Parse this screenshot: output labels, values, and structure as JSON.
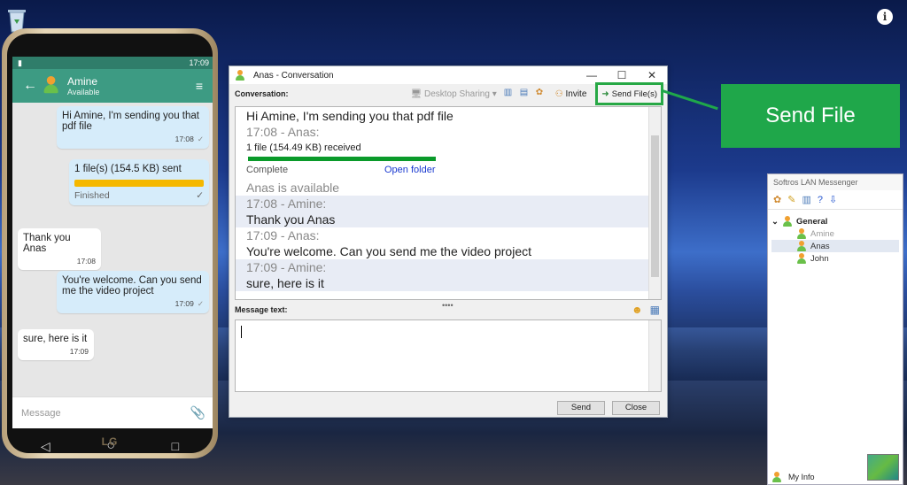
{
  "phone": {
    "status_time": "17:09",
    "contact_name": "Amine",
    "contact_status": "Available",
    "messages": [
      {
        "text": "Hi Amine, I'm sending you that pdf file",
        "time": "17:08"
      },
      {
        "text": "1 file(s)  (154.5 KB) sent",
        "status": "Finished",
        "progress": 1.0
      },
      {
        "text": "Thank you Anas",
        "time": "17:08"
      },
      {
        "text": "You're welcome. Can you send me the video project",
        "time": "17:09"
      },
      {
        "text": "sure, here is it",
        "time": "17:09"
      }
    ],
    "input_placeholder": "Message",
    "brand": "LG"
  },
  "window": {
    "title": "Anas - Conversation",
    "conversation_label": "Conversation:",
    "desktop_sharing": "Desktop Sharing",
    "invite": "Invite",
    "send_files": "Send File(s)",
    "lines": [
      {
        "text": "Hi Amine, I'm sending you that pdf file"
      },
      {
        "text": "17:08 - Anas:"
      },
      {
        "text": "1 file (154.49 KB) received"
      },
      {
        "text": "Complete",
        "link": "Open folder"
      },
      {
        "text": "Anas is available"
      },
      {
        "text": "17:08 - Amine:"
      },
      {
        "text": "Thank you Anas"
      },
      {
        "text": "17:09 - Anas:"
      },
      {
        "text": "You're welcome. Can you send me the video project"
      },
      {
        "text": "17:09 - Amine:"
      },
      {
        "text": "sure, here is it"
      }
    ],
    "message_label": "Message text:",
    "send_button": "Send",
    "close_button": "Close"
  },
  "callout": {
    "text": "Send File"
  },
  "messenger": {
    "title": "Softros LAN Messenger",
    "group": "General",
    "users": [
      "Amine",
      "Anas",
      "John"
    ],
    "my_info": "My Info"
  },
  "colors": {
    "callout_green": "#1fa74a",
    "app_teal": "#3d9b83",
    "progress_yellow": "#f5b800"
  }
}
